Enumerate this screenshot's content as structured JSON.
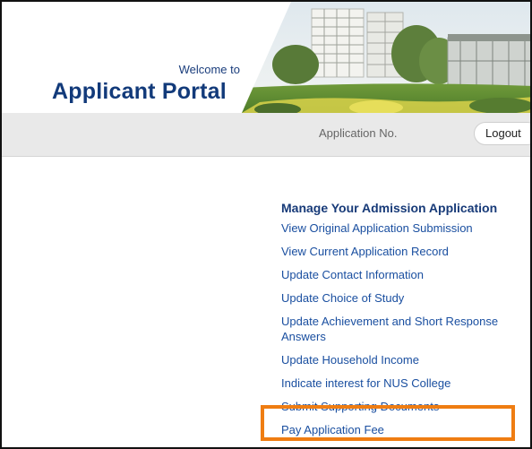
{
  "header": {
    "welcome": "Welcome to",
    "title": "Applicant Portal"
  },
  "bar": {
    "application_no_label": "Application No.",
    "logout_label": "Logout"
  },
  "menu": {
    "heading": "Manage Your Admission Application",
    "items": [
      {
        "label": "View Original Application Submission"
      },
      {
        "label": "View Current Application Record"
      },
      {
        "label": "Update Contact Information"
      },
      {
        "label": "Update Choice of Study"
      },
      {
        "label": "Update Achievement and Short Response Answers"
      },
      {
        "label": "Update Household Income"
      },
      {
        "label": "Indicate interest for NUS College"
      },
      {
        "label": "Submit Supporting Documents"
      },
      {
        "label": "Pay Application Fee"
      }
    ]
  },
  "colors": {
    "brand_navy": "#123a7a",
    "link_blue": "#1a4fa0",
    "highlight_orange": "#ef7d12",
    "bar_gray": "#e9e9e9"
  }
}
